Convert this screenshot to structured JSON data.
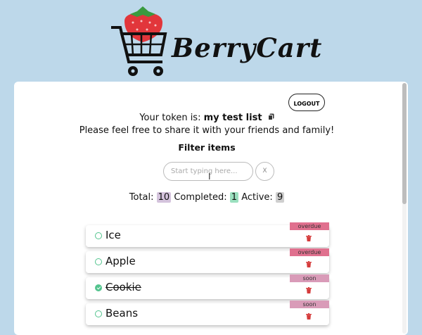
{
  "brand": {
    "name": "BerryCart"
  },
  "header": {
    "logout_label": "LOGOUT"
  },
  "token": {
    "prefix": "Your token is:",
    "name": "my test list",
    "share_text": "Please feel free to share it with your friends and family!"
  },
  "filter": {
    "title": "Filter items",
    "placeholder": "Start typing here...",
    "clear_label": "X"
  },
  "stats": {
    "total_label": "Total:",
    "total": "10",
    "completed_label": "Completed:",
    "completed": "1",
    "active_label": "Active:",
    "active": "9"
  },
  "items": [
    {
      "label": "Ice",
      "tag": "overdue",
      "completed": false
    },
    {
      "label": "Apple",
      "tag": "overdue",
      "completed": false
    },
    {
      "label": "Cookie",
      "tag": "soon",
      "completed": true
    },
    {
      "label": "Beans",
      "tag": "soon",
      "completed": false
    }
  ],
  "icons": {
    "logo": "strawberry-cart-icon",
    "copy": "copy-icon",
    "delete": "trash-icon",
    "check": "check-circle-icon"
  },
  "colors": {
    "background": "#bdd8ea",
    "accent_green": "#53c48e",
    "overdue": "#e0708e",
    "soon": "#d99bb8",
    "delete": "#d53b3b"
  }
}
